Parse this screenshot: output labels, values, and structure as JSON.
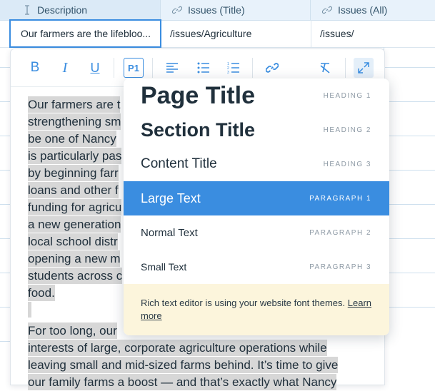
{
  "table": {
    "columns": [
      {
        "label": "Description",
        "icon": "text-cursor-icon"
      },
      {
        "label": "Issues (Title)",
        "icon": "link-icon"
      },
      {
        "label": "Issues (All)",
        "icon": "link-icon"
      }
    ],
    "row": {
      "description": "Our farmers are the lifebloo...",
      "issues_title": "/issues/Agriculture",
      "issues_all": "/issues/"
    }
  },
  "toolbar": {
    "bold": "B",
    "italic": "I",
    "underline": "U",
    "paragraph_style": "P1"
  },
  "editor": {
    "p1_lines": [
      "Our farmers are t",
      "strengthening sm",
      "be one of Nancy",
      "is particularly pas",
      "by beginning farr",
      "loans and other f",
      "funding for agricu",
      "a new generation",
      "local school distr",
      "opening a new m",
      "students across c",
      "food."
    ],
    "p2_lines": [
      "For too long, our",
      "interests of large, corporate agriculture operations while",
      "leaving small and mid-sized farms behind. It’s time to give",
      "our family farms a boost — and that’s exactly what Nancy"
    ]
  },
  "dropdown": {
    "items": [
      {
        "label": "Page Title",
        "tag": "HEADING 1"
      },
      {
        "label": "Section Title",
        "tag": "HEADING 2"
      },
      {
        "label": "Content Title",
        "tag": "HEADING 3"
      },
      {
        "label": "Large Text",
        "tag": "PARAGRAPH 1",
        "selected": true
      },
      {
        "label": "Normal Text",
        "tag": "PARAGRAPH 2"
      },
      {
        "label": "Small Text",
        "tag": "PARAGRAPH 3"
      }
    ],
    "note_text": "Rich text editor is using your website font themes.",
    "note_link": "Learn more"
  },
  "colors": {
    "accent": "#3a8de0",
    "highlight": "#d7d7d7",
    "note_bg": "#fcf5dc",
    "header_bg": "#e8f2fb"
  }
}
